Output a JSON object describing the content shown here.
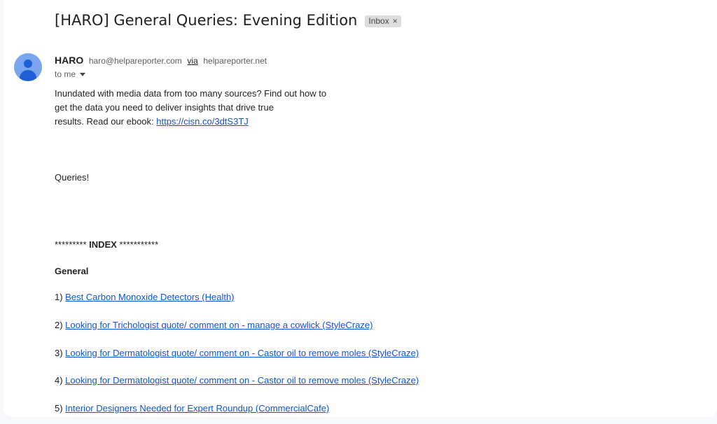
{
  "email": {
    "subject": "[HARO] General Queries: Evening Edition",
    "label": "Inbox",
    "label_remove": "×",
    "sender": {
      "name": "HARO",
      "address": "haro@helpareporter.com",
      "via_word": "via",
      "via_domain": "helpareporter.net"
    },
    "recipient_text": "to me",
    "intro": {
      "line1": "Inundated with media data from too many sources? Find out how to",
      "line2": "get the data you need to deliver insights that drive true",
      "line3_prefix": "results. Read our ebook: ",
      "line3_link": "https://cisn.co/3dtS3TJ"
    },
    "queries_heading": "Queries!",
    "index": {
      "prefix": "********* ",
      "title": "INDEX",
      "suffix": " ***********"
    },
    "section_title": "General",
    "items": [
      {
        "num": "1) ",
        "text": "Best Carbon Monoxide Detectors (Health)"
      },
      {
        "num": "2) ",
        "text": "Looking for Trichologist quote/ comment on - manage a cowlick (StyleCraze)"
      },
      {
        "num": "3) ",
        "text": "Looking for Dermatologist quote/ comment on - Castor oil to remove moles (StyleCraze)"
      },
      {
        "num": "4) ",
        "text": "Looking for Dermatologist quote/ comment on - Castor oil to remove moles (StyleCraze)"
      },
      {
        "num": "5) ",
        "text": "Interior Designers Needed for Expert Roundup (CommercialCafe)"
      }
    ]
  },
  "colors": {
    "link": "#1155cc",
    "avatar_bg": "#7aa6f0",
    "avatar_fg": "#1f5fd6",
    "page_bg": "#f6f8fc",
    "chip_bg": "#dddddd"
  }
}
